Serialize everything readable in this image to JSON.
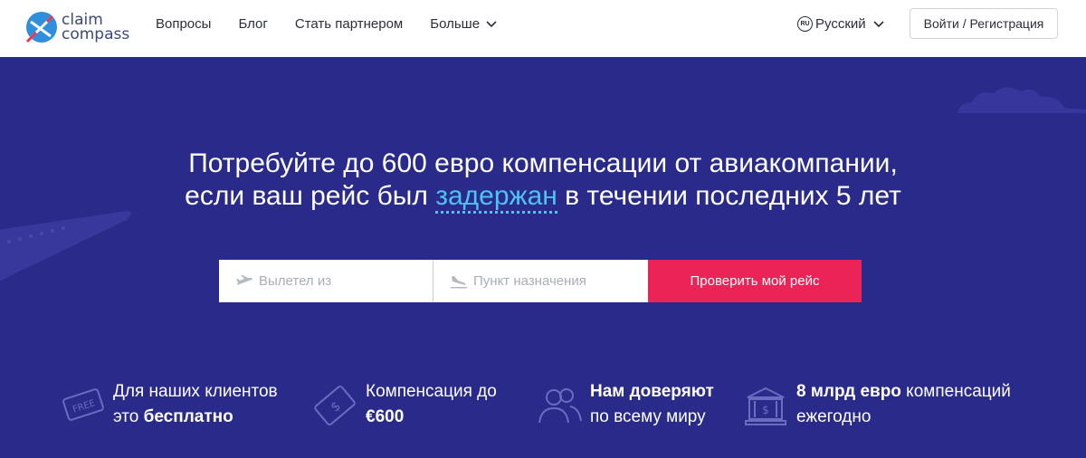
{
  "header": {
    "logo_text_top": "claim",
    "logo_text_bottom": "compass",
    "nav": [
      "Вопросы",
      "Блог",
      "Стать партнером",
      "Больше"
    ],
    "language_flag": "RU",
    "language": "Русский",
    "login_label": "Войти / Регистрация"
  },
  "hero": {
    "headline_line1": "Потребуйте до 600 евро компенсации от авиакомпании,",
    "headline_line2_pre": "если ваш рейс был ",
    "headline_highlight": "задержан",
    "headline_line2_post": " в течении последних 5 лет",
    "from_placeholder": "Вылетел из",
    "to_placeholder": "Пункт назначения",
    "check_button": "Проверить мой рейс"
  },
  "features": [
    {
      "icon": "free-ticket-icon",
      "line1": "Для наших клиентов",
      "line2_pre": "это ",
      "line2_bold": "бесплатно",
      "badge": "FREE"
    },
    {
      "icon": "money-note-icon",
      "line1": "Компенсация до",
      "line2_pre": "",
      "line2_bold": "€600"
    },
    {
      "icon": "people-icon",
      "line1_bold": "Нам доверяют",
      "line2": "по всему миру"
    },
    {
      "icon": "bank-icon",
      "line1_bold": "8 млрд евро",
      "line1_post": " компенсаций",
      "line2": "ежегодно"
    }
  ],
  "colors": {
    "hero_bg": "#2a2a8a",
    "accent": "#ec2356",
    "highlight": "#4ec3f0"
  }
}
